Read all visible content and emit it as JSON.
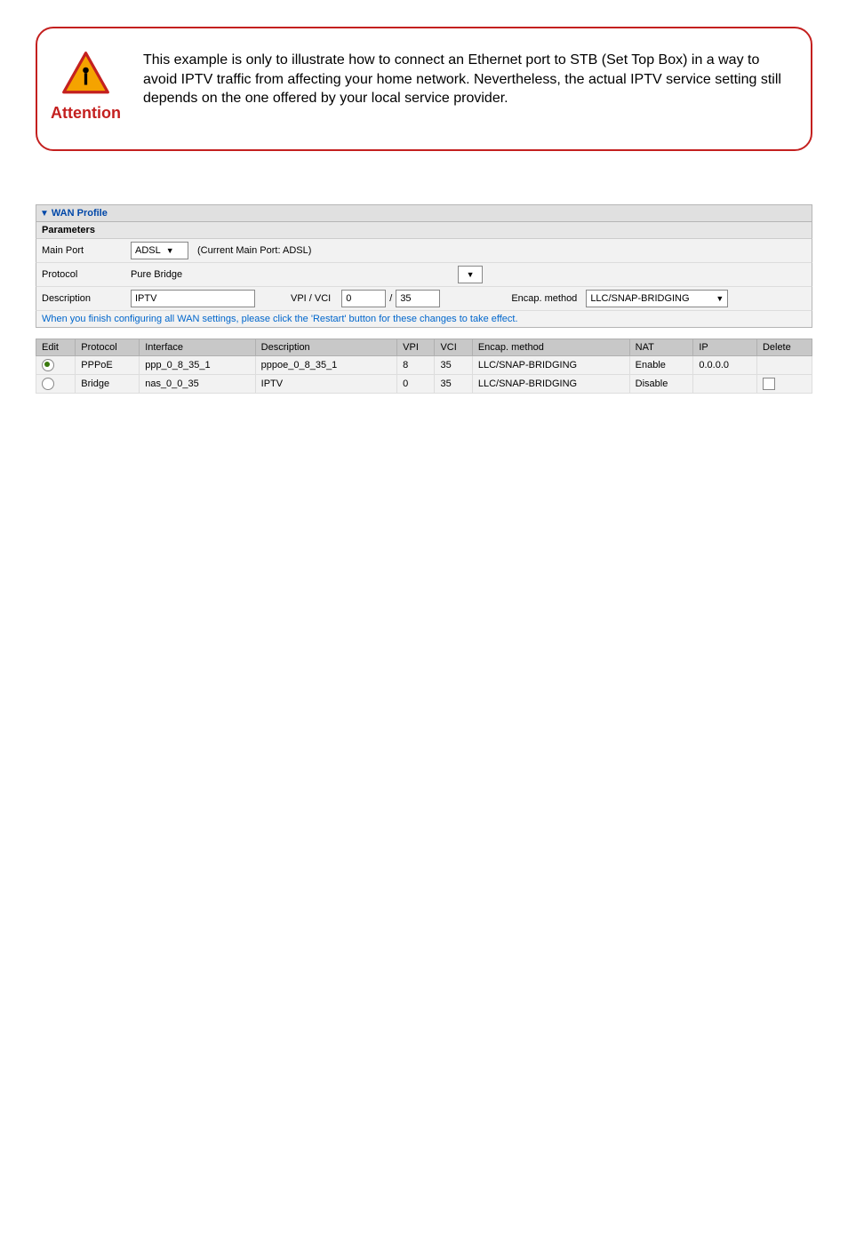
{
  "attention": {
    "label": "Attention",
    "text": "This example is only to illustrate how to connect an Ethernet port to STB (Set Top Box) in a way to avoid IPTV traffic from affecting your home network. Nevertheless, the actual IPTV service setting still depends on the one offered by your local service provider."
  },
  "wan": {
    "title": "WAN Profile",
    "parameters_label": "Parameters",
    "main_port_label": "Main Port",
    "main_port_value": "ADSL",
    "main_port_note": "(Current Main Port: ADSL)",
    "protocol_label": "Protocol",
    "protocol_value": "Pure Bridge",
    "description_label": "Description",
    "description_value": "IPTV",
    "vpi_vci_label": "VPI / VCI",
    "vpi_value": "0",
    "vci_sep": "/",
    "vci_value": "35",
    "encap_label": "Encap. method",
    "encap_value": "LLC/SNAP-BRIDGING",
    "note": "When you finish configuring all WAN settings, please click the 'Restart' button for these changes to take effect."
  },
  "table": {
    "headers": {
      "edit": "Edit",
      "protocol": "Protocol",
      "interface": "Interface",
      "description": "Description",
      "vpi": "VPI",
      "vci": "VCI",
      "encap": "Encap. method",
      "nat": "NAT",
      "ip": "IP",
      "delete": "Delete"
    },
    "rows": [
      {
        "selected": true,
        "protocol": "PPPoE",
        "interface": "ppp_0_8_35_1",
        "description": "pppoe_0_8_35_1",
        "vpi": "8",
        "vci": "35",
        "encap": "LLC/SNAP-BRIDGING",
        "nat": "Enable",
        "ip": "0.0.0.0",
        "deletable": false
      },
      {
        "selected": false,
        "protocol": "Bridge",
        "interface": "nas_0_0_35",
        "description": "IPTV",
        "vpi": "0",
        "vci": "35",
        "encap": "LLC/SNAP-BRIDGING",
        "nat": "Disable",
        "ip": "",
        "deletable": true
      }
    ]
  }
}
